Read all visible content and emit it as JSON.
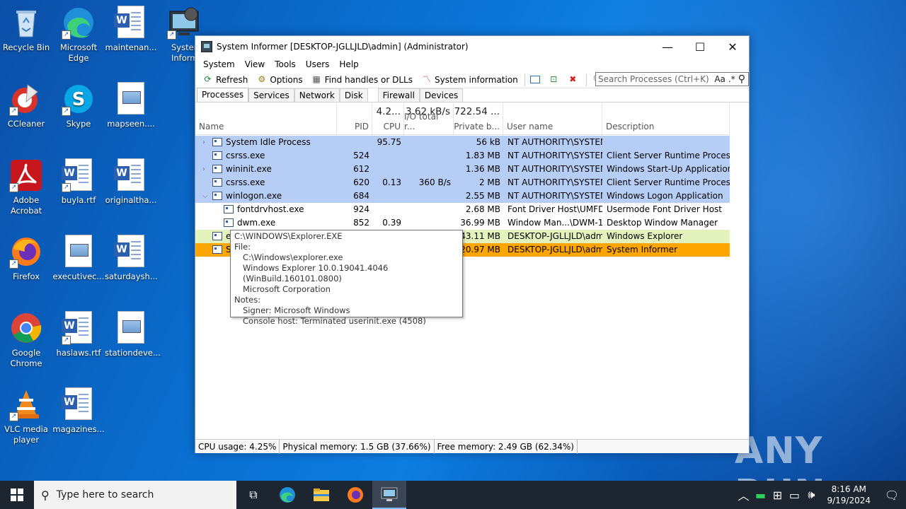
{
  "desktop_icons": [
    {
      "label": "Recycle Bin"
    },
    {
      "label": "Microsoft Edge"
    },
    {
      "label": "maintenan..."
    },
    {
      "label": "System Inform"
    },
    {
      "label": "CCleaner"
    },
    {
      "label": "Skype"
    },
    {
      "label": "mapseen...."
    },
    {
      "label": "Adobe Acrobat"
    },
    {
      "label": "buyla.rtf"
    },
    {
      "label": "originaltha..."
    },
    {
      "label": "Firefox"
    },
    {
      "label": "executivec..."
    },
    {
      "label": "saturdaysh..."
    },
    {
      "label": "Google Chrome"
    },
    {
      "label": "haslaws.rtf"
    },
    {
      "label": "stationdeve..."
    },
    {
      "label": "VLC media player"
    },
    {
      "label": "magazines..."
    }
  ],
  "window": {
    "title": "System Informer [DESKTOP-JGLLJLD\\admin] (Administrator)",
    "menu": [
      "System",
      "View",
      "Tools",
      "Users",
      "Help"
    ],
    "toolbar": {
      "refresh": "Refresh",
      "options": "Options",
      "find": "Find handles or DLLs",
      "sysinfo": "System information"
    },
    "search_placeholder": "Search Processes (Ctrl+K)",
    "search_aa": "Aa",
    "search_regex": ".*",
    "tabs": [
      "Processes",
      "Services",
      "Network",
      "Disk",
      "Firewall",
      "Devices"
    ],
    "columns": {
      "name": "Name",
      "pid": "PID",
      "cpu": "CPU",
      "io": "I/O total r...",
      "private": "Private b...",
      "user": "User name",
      "desc": "Description"
    },
    "totals": {
      "cpu": "4.2...",
      "io": "3.62 kB/s",
      "private": "722.54 ..."
    },
    "rows": [
      {
        "name": "System Idle Process",
        "pid": "",
        "cpu": "95.75",
        "io": "",
        "priv": "56 kB",
        "user": "NT AUTHORITY\\SYSTEM",
        "desc": ""
      },
      {
        "name": "csrss.exe",
        "pid": "524",
        "cpu": "",
        "io": "",
        "priv": "1.83 MB",
        "user": "NT AUTHORITY\\SYSTEM",
        "desc": "Client Server Runtime Process"
      },
      {
        "name": "wininit.exe",
        "pid": "612",
        "cpu": "",
        "io": "",
        "priv": "1.36 MB",
        "user": "NT AUTHORITY\\SYSTEM",
        "desc": "Windows Start-Up Application"
      },
      {
        "name": "csrss.exe",
        "pid": "620",
        "cpu": "0.13",
        "io": "360 B/s",
        "priv": "2 MB",
        "user": "NT AUTHORITY\\SYSTEM",
        "desc": "Client Server Runtime Process"
      },
      {
        "name": "winlogon.exe",
        "pid": "684",
        "cpu": "",
        "io": "",
        "priv": "2.55 MB",
        "user": "NT AUTHORITY\\SYSTEM",
        "desc": "Windows Logon Application"
      },
      {
        "name": "fontdrvhost.exe",
        "pid": "924",
        "cpu": "",
        "io": "",
        "priv": "2.68 MB",
        "user": "Font Driver Host\\UMFD-",
        "desc": "Usermode Font Driver Host"
      },
      {
        "name": "dwm.exe",
        "pid": "852",
        "cpu": "0.39",
        "io": "",
        "priv": "36.99 MB",
        "user": "Window Man...\\DWM-1",
        "desc": "Desktop Window Manager"
      },
      {
        "name": "ex",
        "pid": "",
        "cpu": "",
        "io": "",
        "priv": "43.11 MB",
        "user": "DESKTOP-JGLLJLD\\admi",
        "desc": "Windows Explorer"
      },
      {
        "name": "Sy",
        "pid": "",
        "cpu": "",
        "io": "",
        "priv": "20.97 MB",
        "user": "DESKTOP-JGLLJLD\\admi",
        "desc": "System Informer"
      }
    ],
    "tooltip": {
      "path": "C:\\WINDOWS\\Explorer.EXE",
      "file_label": "File:",
      "file_path": "C:\\Windows\\explorer.exe",
      "version": "Windows Explorer 10.0.19041.4046 (WinBuild.160101.0800)",
      "company": "Microsoft Corporation",
      "notes_label": "Notes:",
      "signer": "Signer: Microsoft Windows",
      "console": "Console host: Terminated userinit.exe (4508)"
    },
    "status": {
      "cpu": "CPU usage: 4.25%",
      "phys": "Physical memory: 1.5 GB (37.66%)",
      "free": "Free memory: 2.49 GB (62.34%)"
    }
  },
  "taskbar": {
    "search_placeholder": "Type here to search",
    "time": "8:16 AM",
    "date": "9/19/2024"
  },
  "watermark": "ANY RUN",
  "colors": {
    "system_rows": "#b6cdf5",
    "explorer_row": "#e4f2bd",
    "informer_row": "#ffa500",
    "taskbar": "#1c2530"
  }
}
